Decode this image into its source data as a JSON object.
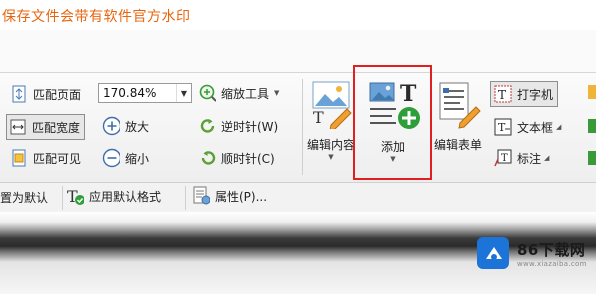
{
  "banner": {
    "text": "保存文件会带有软件官方水印"
  },
  "view_group": {
    "fit_page_label": "匹配页面",
    "fit_width_label": "匹配宽度",
    "fit_visible_label": "匹配可见"
  },
  "zoom_group": {
    "zoom_value": "170.84%",
    "zoom_in_label": "放大",
    "zoom_out_label": "缩小"
  },
  "zoom_tool": {
    "label": "缩放工具"
  },
  "rotate": {
    "ccw_label": "逆时针(W)",
    "cw_label": "顺时针(C)"
  },
  "edit_content": {
    "label": "编辑内容"
  },
  "add": {
    "label": "添加"
  },
  "edit_form": {
    "label": "编辑表单"
  },
  "typewriter_group": {
    "typewriter_label": "打字机",
    "textbox_label": "文本框",
    "callout_label": "标注"
  },
  "row2": {
    "set_default_label": "置为默认",
    "apply_default_format_label": "应用默认格式",
    "properties_label": "属性(P)..."
  },
  "watermark": {
    "name": "86下载网",
    "url": "www.xiazaiba.com"
  },
  "colors": {
    "highlight": "#e02020",
    "banner_text": "#e8650e",
    "logo_blue": "#1d74d8"
  }
}
